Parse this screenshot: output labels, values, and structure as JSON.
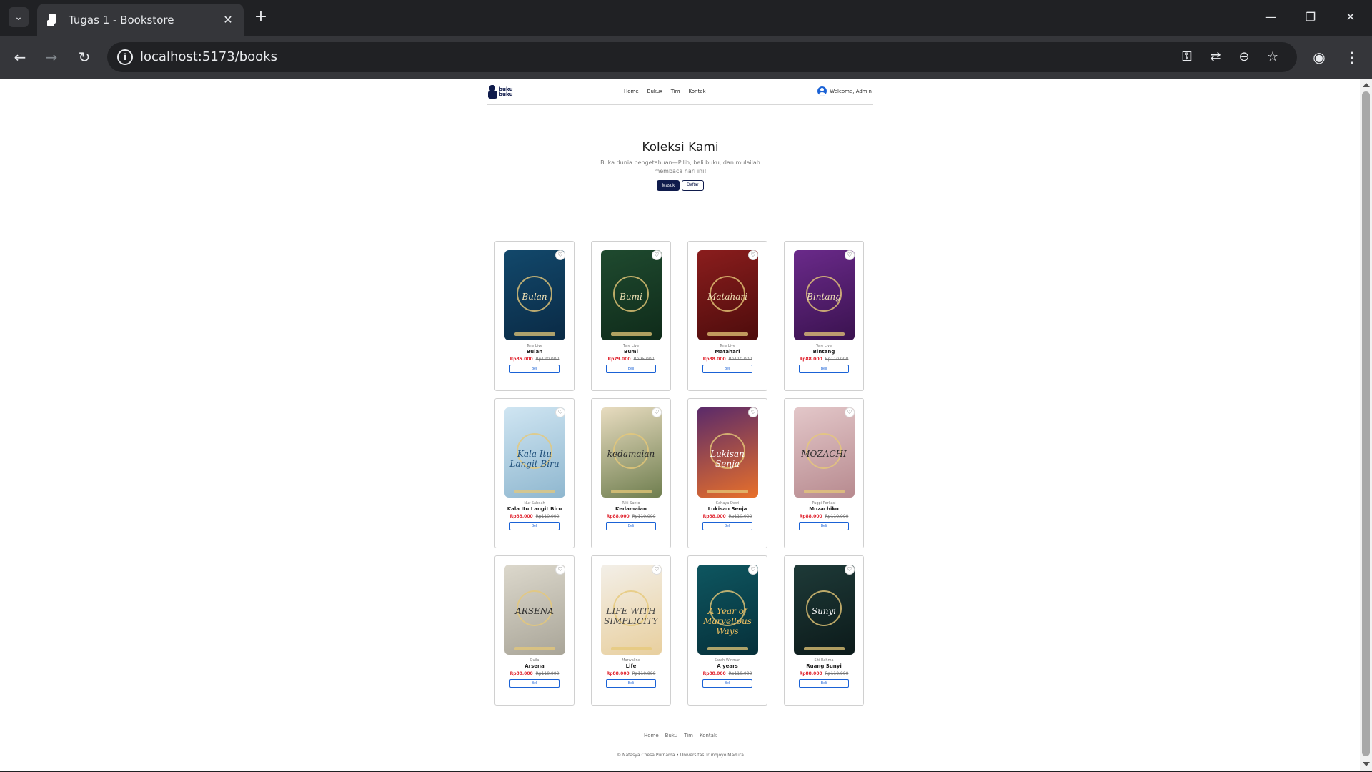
{
  "browser": {
    "tab_title": "Tugas 1 - Bookstore",
    "url": "localhost:5173/books"
  },
  "header": {
    "logo_text": "buku buku",
    "nav": [
      "Home",
      "Buku",
      "Tim",
      "Kontak"
    ],
    "welcome": "Welcome, Admin"
  },
  "hero": {
    "title": "Koleksi Kami",
    "subtitle": "Buka dunia pengetahuan—Pilih, beli buku, dan mulailah membaca hari ini!",
    "login_label": "Masuk",
    "register_label": "Daftar"
  },
  "books": [
    {
      "author": "Tere Liye",
      "title": "Bulan",
      "price": "Rp85.000",
      "old_price": "Rp120.000",
      "buy": "Beli",
      "cover_text": "Bulan",
      "cover_bg": "#12486b",
      "cover_bg2": "#0a2a45",
      "cover_fg": "#f2e3b6"
    },
    {
      "author": "Tere Liye",
      "title": "Bumi",
      "price": "Rp79.000",
      "old_price": "Rp95.000",
      "buy": "Beli",
      "cover_text": "Bumi",
      "cover_bg": "#1f4a2f",
      "cover_bg2": "#0f2b1a",
      "cover_fg": "#f2e3b6"
    },
    {
      "author": "Tere Liye",
      "title": "Matahari",
      "price": "Rp88.000",
      "old_price": "Rp110.000",
      "buy": "Beli",
      "cover_text": "Matahari",
      "cover_bg": "#8a1d1d",
      "cover_bg2": "#4d0c0c",
      "cover_fg": "#f2e3b6"
    },
    {
      "author": "Tere Liye",
      "title": "Bintang",
      "price": "Rp88.000",
      "old_price": "Rp110.000",
      "buy": "Beli",
      "cover_text": "Bintang",
      "cover_bg": "#6a2a8a",
      "cover_bg2": "#3a124f",
      "cover_fg": "#f2e3b6"
    },
    {
      "author": "Nur Sabdah",
      "title": "Kala Itu Langit Biru",
      "price": "Rp88.000",
      "old_price": "Rp110.000",
      "buy": "Beli",
      "cover_text": "Kala Itu Langit Biru",
      "cover_bg": "#cfe5f2",
      "cover_bg2": "#8fb7cf",
      "cover_fg": "#1f4f7a"
    },
    {
      "author": "Riki Santo",
      "title": "Kedamaian",
      "price": "Rp88.000",
      "old_price": "Rp110.000",
      "buy": "Beli",
      "cover_text": "kedamaian",
      "cover_bg": "#e8dcc0",
      "cover_bg2": "#6f7e4f",
      "cover_fg": "#2a2a2a"
    },
    {
      "author": "Cahaya Dewi",
      "title": "Lukisan Senja",
      "price": "Rp88.000",
      "old_price": "Rp110.000",
      "buy": "Beli",
      "cover_text": "Lukisan Senja",
      "cover_bg": "#5a2a6a",
      "cover_bg2": "#e8702a",
      "cover_fg": "#ffffff"
    },
    {
      "author": "Pagpi Perkasi",
      "title": "Mozachiko",
      "price": "Rp88.000",
      "old_price": "Rp110.000",
      "buy": "Beli",
      "cover_text": "MOZACHI",
      "cover_bg": "#e3c7c9",
      "cover_bg2": "#b78a8f",
      "cover_fg": "#2a2a2a"
    },
    {
      "author": "Quila",
      "title": "Arsena",
      "price": "Rp88.000",
      "old_price": "Rp110.000",
      "buy": "Beli",
      "cover_text": "ARSENA",
      "cover_bg": "#dcd8cc",
      "cover_bg2": "#a9a598",
      "cover_fg": "#2a2a2a"
    },
    {
      "author": "Marwaline",
      "title": "Life",
      "price": "Rp88.000",
      "old_price": "Rp110.000",
      "buy": "Beli",
      "cover_text": "LIFE WITH SIMPLICITY",
      "cover_bg": "#f3efe8",
      "cover_bg2": "#e8cf9e",
      "cover_fg": "#444444"
    },
    {
      "author": "Sarah Winman",
      "title": "A years",
      "price": "Rp88.000",
      "old_price": "Rp110.000",
      "buy": "Beli",
      "cover_text": "A Year of Marvellous Ways",
      "cover_bg": "#0e5660",
      "cover_bg2": "#06303a",
      "cover_fg": "#f0c060"
    },
    {
      "author": "Siti Rahma",
      "title": "Ruang Sunyi",
      "price": "Rp88.000",
      "old_price": "Rp110.000",
      "buy": "Beli",
      "cover_text": "Sunyi",
      "cover_bg": "#1e3a38",
      "cover_bg2": "#0c1a1a",
      "cover_fg": "#ffffff"
    }
  ],
  "footer": {
    "nav": [
      "Home",
      "Buku",
      "Tim",
      "Kontak"
    ],
    "copyright": "© Natasya Chesa Purnama • Universitas Trunojoyo Madura"
  }
}
